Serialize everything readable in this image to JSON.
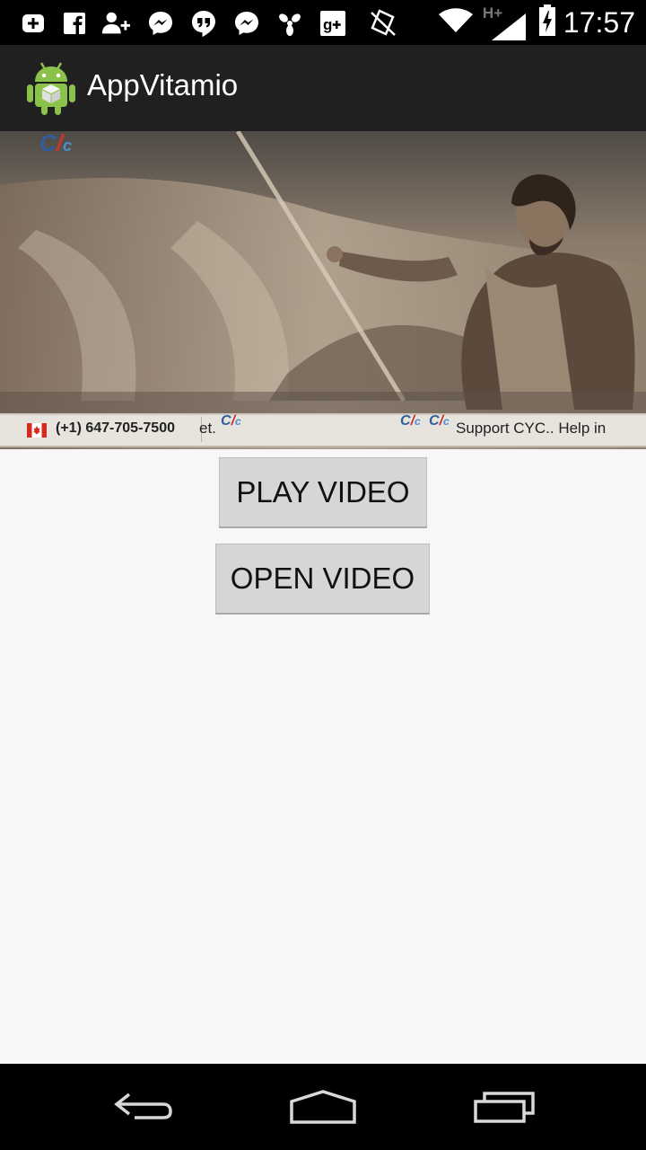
{
  "status_bar": {
    "time": "17:57",
    "network_type": "H+",
    "icons": [
      "notification-add-icon",
      "facebook-icon",
      "add-contact-icon",
      "messenger-icon",
      "hangouts-icon",
      "messenger-icon",
      "pinwheel-icon",
      "google-plus-icon",
      "no-sim-icon",
      "wifi-icon",
      "signal-icon",
      "battery-charging-icon"
    ]
  },
  "action_bar": {
    "title": "AppVitamio",
    "icon": "android-app-icon"
  },
  "video": {
    "ticker_phone": "(+1) 647-705-7500",
    "ticker_fragment": "et.",
    "ticker_text": "Support CYC.. Help in",
    "logo_text": "CYC"
  },
  "buttons": {
    "play_label": "PLAY VIDEO",
    "open_label": "OPEN VIDEO"
  },
  "nav_bar": {
    "icons": [
      "back-icon",
      "home-icon",
      "recent-apps-icon"
    ]
  }
}
